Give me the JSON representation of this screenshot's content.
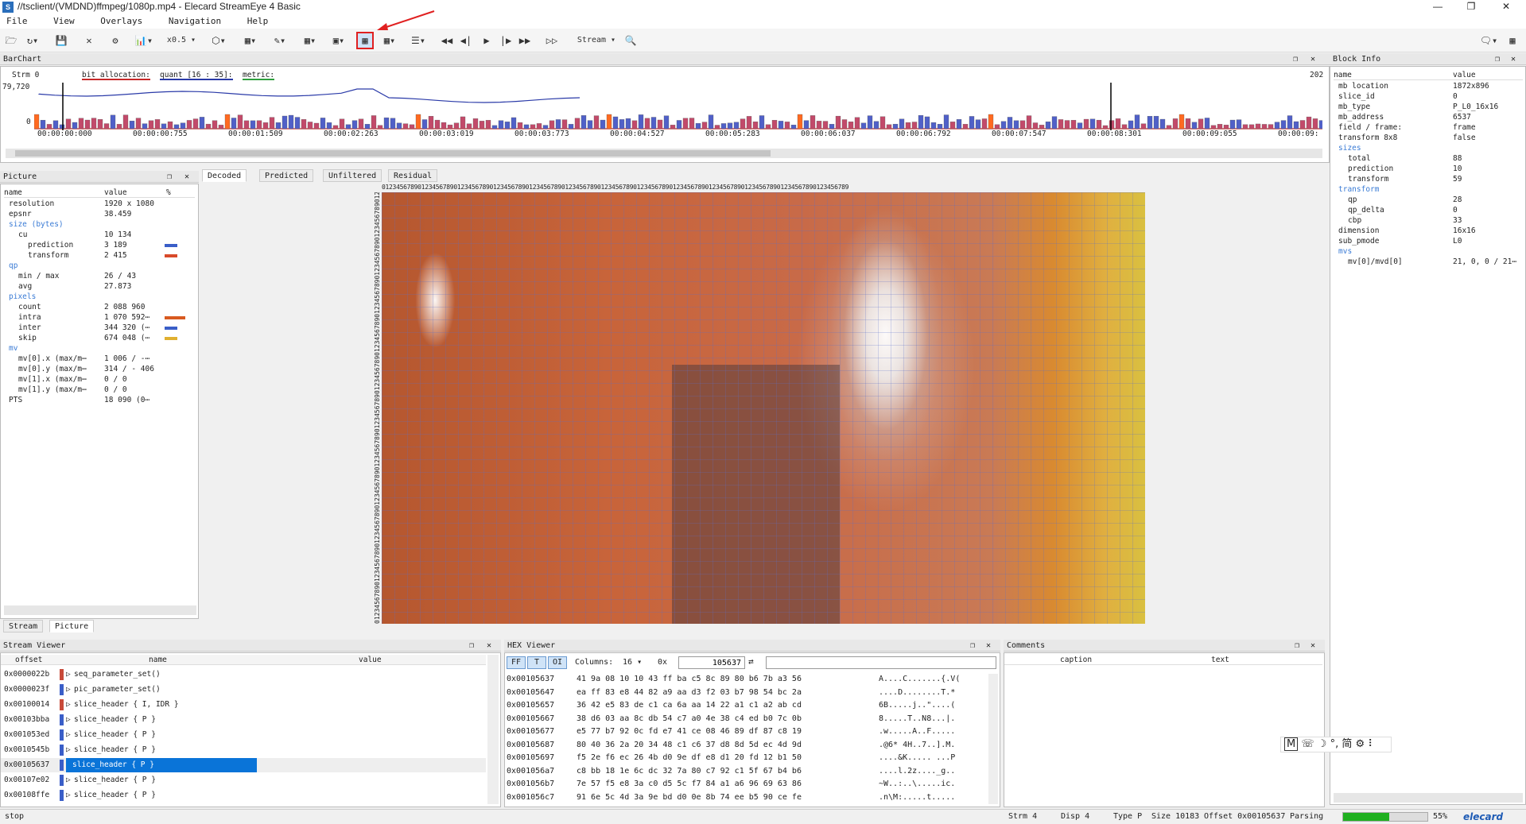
{
  "window": {
    "title": "//tsclient/(VMDND)ffmpeg/1080p.mp4 - Elecard StreamEye 4 Basic",
    "icon_letter": "S"
  },
  "menu": [
    "File",
    "View",
    "Overlays",
    "Navigation",
    "Help"
  ],
  "toolbar": {
    "zoom": "x0.5",
    "stream_label": "Stream"
  },
  "barchart": {
    "title": "BarChart",
    "strm": "Strm 0",
    "ymax": "79,720",
    "yzero": "0",
    "right_count": "202",
    "legend": {
      "bit": "bit allocation:",
      "quant": "quant [16 : 35]:",
      "metric": "metric:"
    },
    "timeline": [
      "00:00:00:000",
      "00:00:00:755",
      "00:00:01:509",
      "00:00:02:263",
      "00:00:03:019",
      "00:00:03:773",
      "00:00:04:527",
      "00:00:05:283",
      "00:00:06:037",
      "00:00:06:792",
      "00:00:07:547",
      "00:00:08:301",
      "00:00:09:055",
      "00:00:09:"
    ]
  },
  "picture": {
    "title": "Picture",
    "headers": [
      "name",
      "value",
      "%"
    ],
    "rows": [
      {
        "name": "resolution",
        "value": "1920 x 1080",
        "type": "kv"
      },
      {
        "name": "epsnr",
        "value": "38.459",
        "type": "kv"
      },
      {
        "name": "size (bytes)",
        "value": "",
        "type": "sec"
      },
      {
        "name": "cu",
        "value": "10 134",
        "type": "kv1"
      },
      {
        "name": "prediction",
        "value": "3 189",
        "type": "kv2",
        "bar": "blue"
      },
      {
        "name": "transform",
        "value": "2 415",
        "type": "kv2",
        "bar": "red"
      },
      {
        "name": "qp",
        "value": "",
        "type": "sec"
      },
      {
        "name": "min / max",
        "value": "26 / 43",
        "type": "kv1"
      },
      {
        "name": "avg",
        "value": "27.873",
        "type": "kv1"
      },
      {
        "name": "pixels",
        "value": "",
        "type": "sec"
      },
      {
        "name": "count",
        "value": "2 088 960",
        "type": "kv1"
      },
      {
        "name": "intra",
        "value": "1 070 592⋯",
        "type": "kv1",
        "bar": "orange"
      },
      {
        "name": "inter",
        "value": "344 320 (⋯",
        "type": "kv1",
        "bar": "blue"
      },
      {
        "name": "skip",
        "value": "674 048 (⋯",
        "type": "kv1",
        "bar": "yellow"
      },
      {
        "name": "mv",
        "value": "",
        "type": "sec"
      },
      {
        "name": "mv[0].x (max/m⋯",
        "value": "1 006 / -⋯",
        "type": "kv1"
      },
      {
        "name": "mv[0].y (max/m⋯",
        "value": "314 / - 406",
        "type": "kv1"
      },
      {
        "name": "mv[1].x (max/m⋯",
        "value": "0 / 0",
        "type": "kv1"
      },
      {
        "name": "mv[1].y (max/m⋯",
        "value": "0 / 0",
        "type": "kv1"
      },
      {
        "name": "PTS",
        "value": "18 090 (0⋯",
        "type": "kv"
      }
    ],
    "bottom_tabs": [
      "Stream",
      "Picture"
    ]
  },
  "view_tabs": [
    "Decoded",
    "Predicted",
    "Unfiltered",
    "Residual"
  ],
  "ruler_digits": "0123456789012345678901234567890123456789012345678901234567890123456789012345678901234567890123456789012345678901234567890123456789",
  "block_info": {
    "title": "Block Info",
    "headers": [
      "name",
      "value"
    ],
    "rows": [
      {
        "name": "mb location",
        "value": "1872x896",
        "type": "kv"
      },
      {
        "name": "slice_id",
        "value": "0",
        "type": "kv"
      },
      {
        "name": "mb_type",
        "value": "P_L0_16x16",
        "type": "kv"
      },
      {
        "name": "mb_address",
        "value": "6537",
        "type": "kv"
      },
      {
        "name": "field / frame:",
        "value": "frame",
        "type": "kv"
      },
      {
        "name": "transform 8x8",
        "value": "false",
        "type": "kv"
      },
      {
        "name": "sizes",
        "value": "",
        "type": "sec"
      },
      {
        "name": "total",
        "value": "88",
        "type": "kv1"
      },
      {
        "name": "prediction",
        "value": "10",
        "type": "kv1"
      },
      {
        "name": "transform",
        "value": "59",
        "type": "kv1"
      },
      {
        "name": "transform",
        "value": "",
        "type": "sec"
      },
      {
        "name": "qp",
        "value": "28",
        "type": "kv1"
      },
      {
        "name": "qp_delta",
        "value": "0",
        "type": "kv1"
      },
      {
        "name": "cbp",
        "value": "33",
        "type": "kv1"
      },
      {
        "name": "dimension",
        "value": "16x16",
        "type": "kv"
      },
      {
        "name": "sub_pmode",
        "value": "L0",
        "type": "kv"
      },
      {
        "name": "mvs",
        "value": "",
        "type": "sec"
      },
      {
        "name": "mv[0]/mvd[0]",
        "value": "21, 0, 0 / 21⋯",
        "type": "kv1"
      }
    ]
  },
  "stream_viewer": {
    "title": "Stream Viewer",
    "headers": [
      "offset",
      "name",
      "value"
    ],
    "rows": [
      {
        "offset": "0x0000022b",
        "name": "seq_parameter_set()",
        "color": "#c84a3a"
      },
      {
        "offset": "0x0000023f",
        "name": "pic_parameter_set()",
        "color": "#3a5ec8"
      },
      {
        "offset": "0x00100014",
        "name": "slice_header { I, IDR }",
        "color": "#c84a3a"
      },
      {
        "offset": "0x00103bba",
        "name": "slice_header { P }",
        "color": "#3a5ec8"
      },
      {
        "offset": "0x001053ed",
        "name": "slice_header { P }",
        "color": "#3a5ec8"
      },
      {
        "offset": "0x0010545b",
        "name": "slice_header { P }",
        "color": "#3a5ec8"
      },
      {
        "offset": "0x00105637",
        "name": "slice_header { P }",
        "color": "#3a5ec8",
        "selected": true
      },
      {
        "offset": "0x00107e02",
        "name": "slice_header { P }",
        "color": "#3a5ec8"
      },
      {
        "offset": "0x00108ffe",
        "name": "slice_header { P }",
        "color": "#3a5ec8"
      }
    ]
  },
  "hex_viewer": {
    "title": "HEX Viewer",
    "modes": [
      "FF",
      "T",
      "OI"
    ],
    "columns_label": "Columns:",
    "columns_value": "16",
    "hex_prefix": "0x",
    "address": "105637",
    "rows": [
      {
        "addr": "0x00105637",
        "bytes": "41 9a 08 10 10 43 ff ba c5 8c 89 80 b6 7b a3 56",
        "ascii": "A....C.......{.V("
      },
      {
        "addr": "0x00105647",
        "bytes": "ea ff 83 e8 44 82 a9 aa d3 f2 03 b7 98 54 bc 2a",
        "ascii": "....D........T.*"
      },
      {
        "addr": "0x00105657",
        "bytes": "36 42 e5 83 de c1 ca 6a aa 14 22 a1 c1 a2 ab cd",
        "ascii": "6B.....j..\"....("
      },
      {
        "addr": "0x00105667",
        "bytes": "38 d6 03 aa 8c db 54 c7 a0 4e 38 c4 ed b0 7c 0b",
        "ascii": "8.....T..N8...|."
      },
      {
        "addr": "0x00105677",
        "bytes": "e5 77 b7 92 0c fd e7 41 ce 08 46 89 df 87 c8 19",
        "ascii": ".w.....A..F....."
      },
      {
        "addr": "0x00105687",
        "bytes": "80 40 36 2a 20 34 48 c1 c6 37 d8 8d 5d ec 4d 9d",
        "ascii": ".@6* 4H..7..].M."
      },
      {
        "addr": "0x00105697",
        "bytes": "f5 2e f6 ec 26 4b d0 9e df e8 d1 20 fd 12 b1 50",
        "ascii": "....&K..... ...P"
      },
      {
        "addr": "0x001056a7",
        "bytes": "c8 bb 18 1e 6c dc 32 7a 80 c7 92 c1 5f 67 b4 b6",
        "ascii": "....l.2z...._g.."
      },
      {
        "addr": "0x001056b7",
        "bytes": "7e 57 f5 e8 3a c0 d5 5c f7 84 a1 a6 96 69 63 86",
        "ascii": "~W..:..\\.....ic."
      },
      {
        "addr": "0x001056c7",
        "bytes": "91 6e 5c 4d 3a 9e bd d0 0e 8b 74 ee b5 90 ce fe",
        "ascii": ".n\\M:.....t....."
      }
    ]
  },
  "comments": {
    "title": "Comments",
    "headers": [
      "caption",
      "text"
    ]
  },
  "ime": {
    "items": [
      "M",
      "☏",
      "☽",
      "°,",
      "简",
      "⚙",
      "⠇"
    ]
  },
  "status": {
    "left": "stop",
    "strm": "Strm 4",
    "disp": "Disp 4",
    "type": "Type P",
    "size": "Size 10183",
    "offset": "Offset 0x00105637",
    "parsing": "Parsing",
    "progress": 0.55,
    "progress_label": "55%",
    "brand": "elecard"
  }
}
